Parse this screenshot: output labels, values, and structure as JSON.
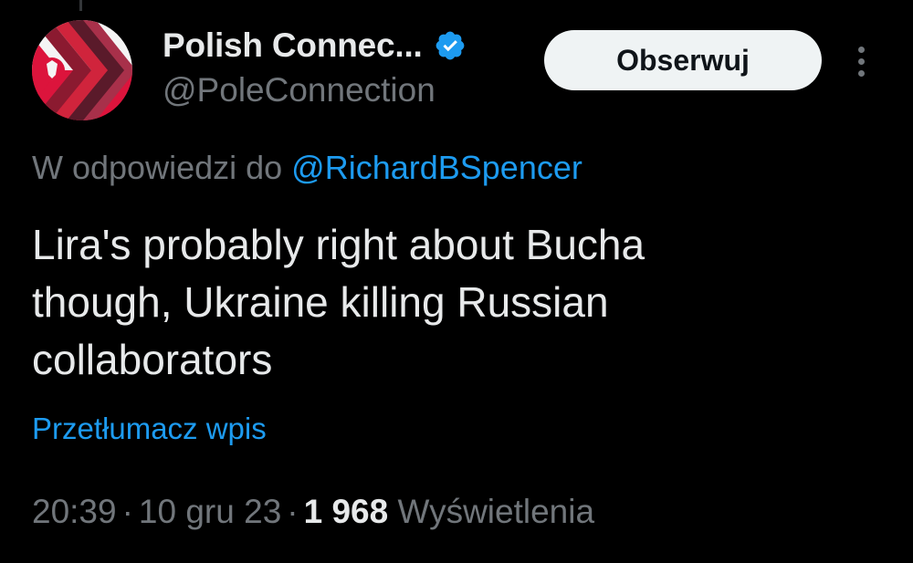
{
  "author": {
    "display_name": "Polish Connec...",
    "handle": "@PoleConnection",
    "verified_icon": "verified-badge-icon",
    "avatar_icon": "flag-chevron-logo-icon"
  },
  "actions": {
    "follow_label": "Obserwuj",
    "more_icon": "more-vertical-icon"
  },
  "reply": {
    "prefix": "W odpowiedzi do",
    "mention": "@RichardBSpencer"
  },
  "tweet": {
    "lines": [
      "Lira's probably right about Bucha",
      "though, Ukraine killing Russian",
      "collaborators"
    ],
    "translate_label": "Przetłumacz wpis"
  },
  "meta": {
    "time": "20:39",
    "date": "10 gru 23",
    "separator": "·",
    "views_count": "1 968",
    "views_label": "Wyświetlenia"
  },
  "colors": {
    "background": "#000000",
    "text_primary": "#e7e9ea",
    "text_secondary": "#71767b",
    "accent_blue": "#1d9bf0",
    "follow_bg": "#eff3f4",
    "flag_red": "#dc143c",
    "chevron_dark": "#5a1a2a"
  }
}
